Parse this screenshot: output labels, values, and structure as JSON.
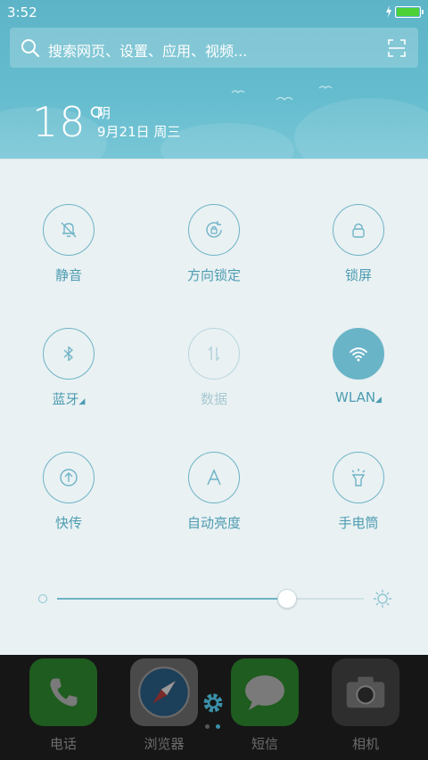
{
  "status_bar": {
    "time": "3:52",
    "battery_level": 1.0,
    "charging": true,
    "battery_color": "#4cd137"
  },
  "search": {
    "placeholder": "搜索网页、设置、应用、视频..."
  },
  "weather": {
    "temperature": "18°",
    "condition": "阴",
    "date": "9月21日 周三"
  },
  "toggles": [
    {
      "id": "mute",
      "label": "静音",
      "icon": "bell-off-icon",
      "state": "off"
    },
    {
      "id": "rotation_lock",
      "label": "方向锁定",
      "icon": "rotation-lock-icon",
      "state": "off"
    },
    {
      "id": "lock_screen",
      "label": "锁屏",
      "icon": "lock-icon",
      "state": "off"
    },
    {
      "id": "bluetooth",
      "label": "蓝牙",
      "icon": "bluetooth-icon",
      "state": "off",
      "has_menu": true
    },
    {
      "id": "data",
      "label": "数据",
      "icon": "data-arrows-icon",
      "state": "disabled"
    },
    {
      "id": "wlan",
      "label": "WLAN",
      "icon": "wifi-icon",
      "state": "on",
      "has_menu": true
    },
    {
      "id": "quick_transfer",
      "label": "快传",
      "icon": "upload-icon",
      "state": "off"
    },
    {
      "id": "auto_brightness",
      "label": "自动亮度",
      "icon": "letter-a-icon",
      "state": "off"
    },
    {
      "id": "flashlight",
      "label": "手电筒",
      "icon": "flashlight-icon",
      "state": "off"
    }
  ],
  "menu_indicator": "◢",
  "brightness": {
    "level": 0.75
  },
  "dock": {
    "apps": [
      {
        "label": "电话",
        "icon": "phone-icon",
        "color": "#1f5c1f"
      },
      {
        "label": "浏览器",
        "icon": "compass-icon",
        "color": "#4a4a4a"
      },
      {
        "label": "短信",
        "icon": "message-bubble-icon",
        "color": "#1f5c1f"
      },
      {
        "label": "相机",
        "icon": "camera-icon",
        "color": "#2e2e2e"
      }
    ],
    "page_count": 2,
    "active_page": 1
  },
  "colors": {
    "accent": "#6ab4c7",
    "label": "#4d9cb1",
    "panel_bg": "#e9f1f3",
    "header_bg": "#64bcce"
  }
}
